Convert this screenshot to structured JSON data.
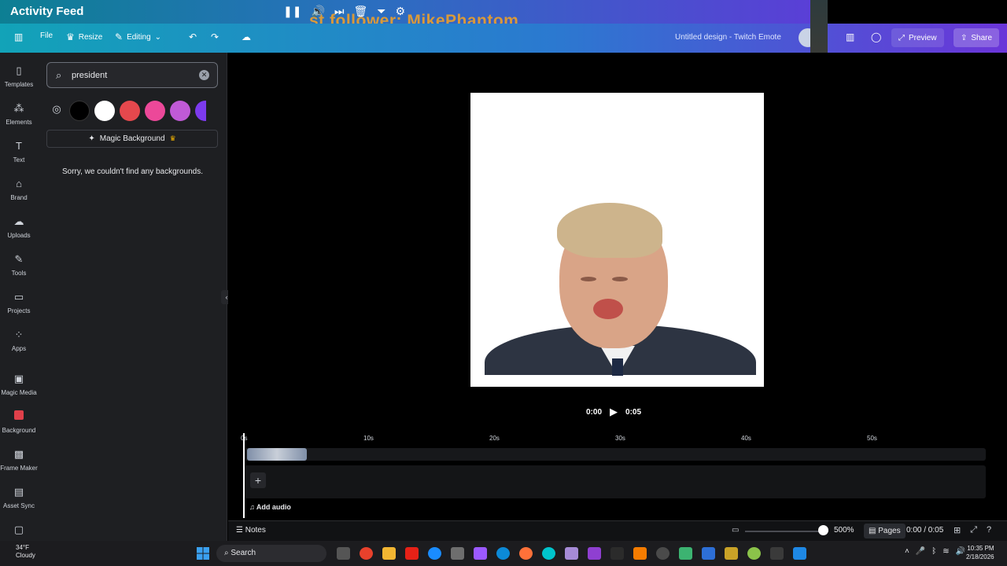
{
  "overlay": {
    "title": "Activity Feed",
    "follower_text": "st follower: MikePhantom",
    "controls": [
      "pause-icon",
      "volume-icon",
      "skip-icon",
      "trash-icon",
      "filter-icon",
      "settings-icon"
    ]
  },
  "topbar": {
    "file_label": "File",
    "resize_label": "Resize",
    "editing_label": "Editing",
    "doc_title": "Untitled design - Twitch Emote",
    "preview_label": "Preview",
    "share_label": "Share"
  },
  "sidebar": {
    "items": [
      {
        "label": "Templates",
        "icon": "templates-icon"
      },
      {
        "label": "Elements",
        "icon": "elements-icon"
      },
      {
        "label": "Text",
        "icon": "text-icon"
      },
      {
        "label": "Brand",
        "icon": "brand-icon"
      },
      {
        "label": "Uploads",
        "icon": "uploads-icon"
      },
      {
        "label": "Tools",
        "icon": "tools-icon"
      },
      {
        "label": "Projects",
        "icon": "projects-icon"
      },
      {
        "label": "Apps",
        "icon": "apps-icon"
      },
      {
        "label": "Magic Media",
        "icon": "magic-media-icon"
      },
      {
        "label": "Background",
        "icon": "background-icon"
      },
      {
        "label": "Frame Maker",
        "icon": "frame-maker-icon"
      },
      {
        "label": "Asset Sync",
        "icon": "asset-sync-icon"
      }
    ]
  },
  "panel": {
    "search_value": "president",
    "swatches": [
      "#000000",
      "#ffffff",
      "#e5484d",
      "#ec4899",
      "#c05ad6",
      "#7c3aed"
    ],
    "magic_background_label": "Magic Background",
    "empty_message": "Sorry, we couldn't find any backgrounds."
  },
  "playback": {
    "current": "0:00",
    "duration": "0:05"
  },
  "timeline": {
    "ticks": [
      "0s",
      "10s",
      "20s",
      "30s",
      "40s",
      "50s"
    ],
    "add_audio_label": "Add audio"
  },
  "bottombar": {
    "notes_label": "Notes",
    "zoom": "500%",
    "pages_label": "Pages",
    "page_time": "0:00 / 0:05"
  },
  "taskbar": {
    "temp": "34°F",
    "condition": "Cloudy",
    "search_label": "Search",
    "time": "10:35 PM",
    "date": "2/18/2026"
  },
  "colors": {
    "accent_teal": "#12a3b8",
    "accent_purple": "#6b35d9",
    "canvas_bg": "#000000"
  }
}
